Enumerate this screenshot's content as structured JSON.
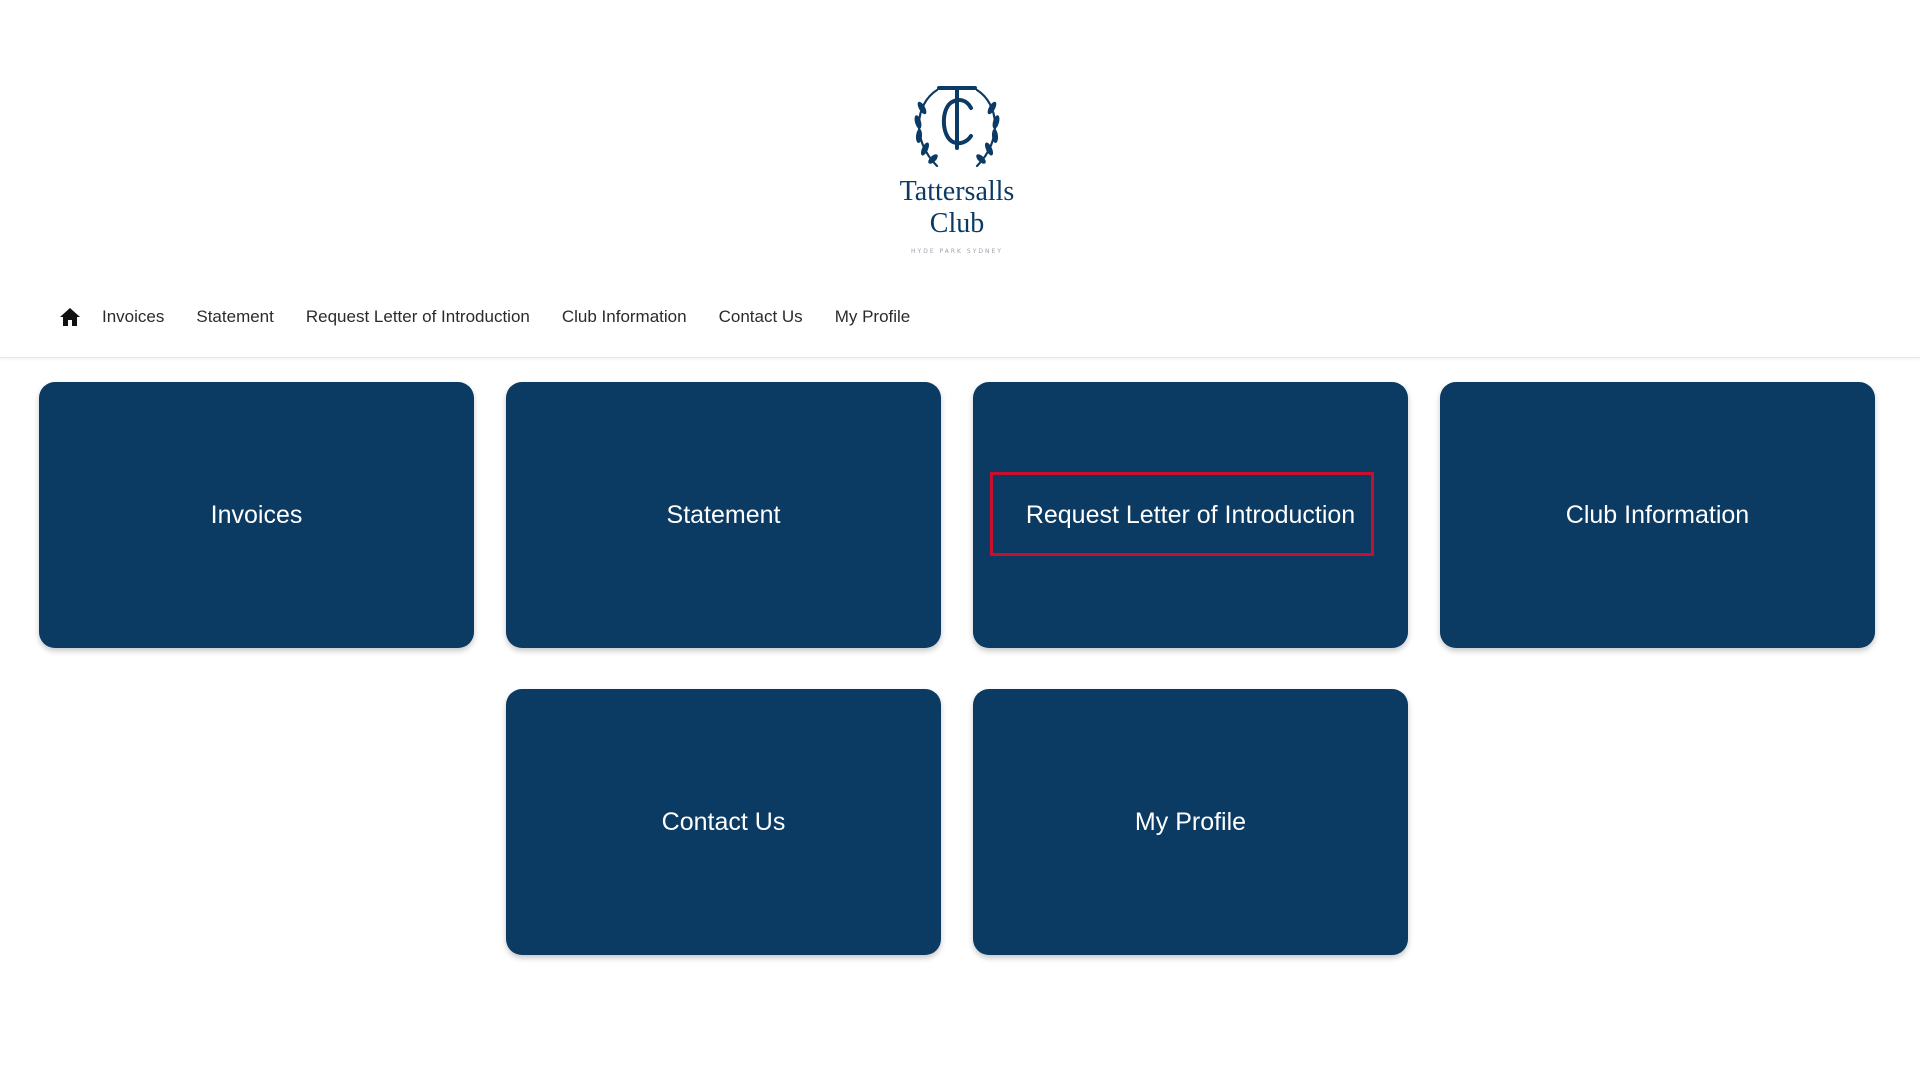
{
  "logo": {
    "monogram": "TC",
    "name_line1": "Tattersalls",
    "name_line2": "Club",
    "tagline": "HYDE PARK SYDNEY",
    "brand_color": "#0b3a64"
  },
  "nav": {
    "home_icon": "home-icon",
    "items": [
      {
        "label": "Invoices"
      },
      {
        "label": "Statement"
      },
      {
        "label": "Request Letter of Introduction"
      },
      {
        "label": "Club Information"
      },
      {
        "label": "Contact Us"
      },
      {
        "label": "My Profile"
      }
    ]
  },
  "tiles": [
    {
      "label": "Invoices"
    },
    {
      "label": "Statement"
    },
    {
      "label": "Request Letter of Introduction",
      "highlighted": true
    },
    {
      "label": "Club Information"
    },
    {
      "label": "Contact Us"
    },
    {
      "label": "My Profile"
    }
  ],
  "colors": {
    "tile_background": "#0b3a62",
    "tile_text": "#ffffff",
    "highlight_border": "#c8102e",
    "nav_text": "#2b2b2b"
  }
}
